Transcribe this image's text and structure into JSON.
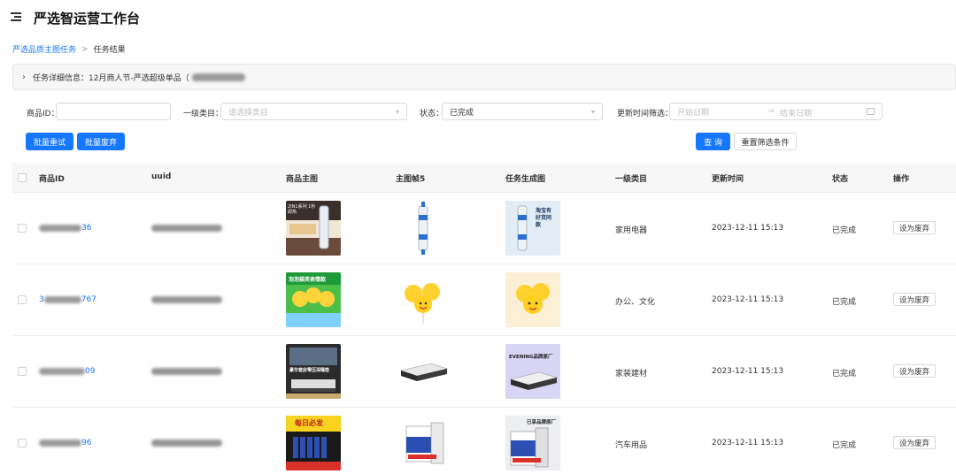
{
  "header": {
    "title": "严选智运营工作台",
    "menu_icon": "menu-fold-icon"
  },
  "breadcrumb": {
    "parent": "严选品质主图任务",
    "separator": ">",
    "current": "任务结果"
  },
  "task_panel": {
    "label": "任务详细信息：12月商人节-严选超级单品（"
  },
  "filters": {
    "product_id": {
      "label": "商品ID：",
      "value": ""
    },
    "category": {
      "label": "一级类目：",
      "placeholder": "请选择类目"
    },
    "status": {
      "label": "状态：",
      "value": "已完成"
    },
    "update_time": {
      "label": "更新时间筛选：",
      "start_placeholder": "开始日期",
      "arrow": "→",
      "end_placeholder": "结束日期"
    }
  },
  "actions": {
    "batch_retry": "批量重试",
    "batch_discard": "批量废弃",
    "query": "查 询",
    "reset": "重置筛选条件"
  },
  "table": {
    "columns": [
      "商品ID",
      "uuid",
      "商品主图",
      "主图帧5",
      "任务生成图",
      "一级类目",
      "更新时间",
      "状态",
      "操作"
    ],
    "rows": [
      {
        "id_suffix": "36",
        "category": "家用电器",
        "time": "2023-12-11 15:13",
        "status": "已完成",
        "action": "设为废弃"
      },
      {
        "id_prefix": "3",
        "id_suffix": "767",
        "category": "办公、文化",
        "time": "2023-12-11 15:13",
        "status": "已完成",
        "action": "设为废弃"
      },
      {
        "id_suffix": "09",
        "category": "家装建材",
        "time": "2023-12-11 15:13",
        "status": "已完成",
        "action": "设为废弃"
      },
      {
        "id_suffix": "96",
        "category": "汽车用品",
        "time": "2023-12-11 15:13",
        "status": "已完成",
        "action": "设为废弃"
      }
    ]
  },
  "thumbnail_text": {
    "r1_main": "2IN1系列 1秒即热",
    "r1_gen": "淘宝有好货同款",
    "r2_main": "泡泡猫笑表情款",
    "r3_main": "豪华套房零压深睡垫",
    "r3_gen": "EVENING品牌原厂",
    "r4_main": "每日必发",
    "r4_gen": "已享品牌原厂"
  },
  "colors": {
    "primary": "#1677ff",
    "header_bg": "#f7f7f8"
  }
}
